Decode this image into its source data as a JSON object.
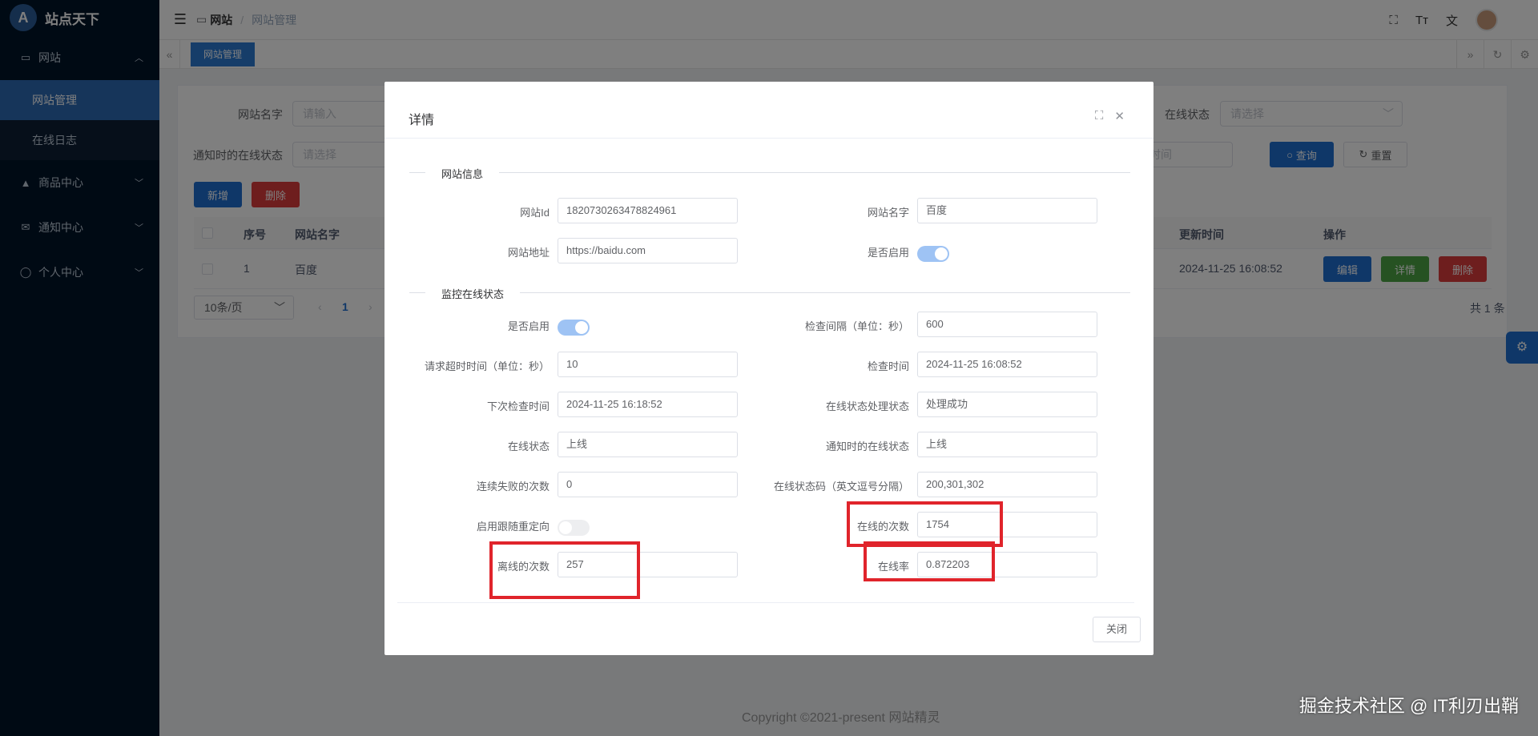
{
  "app": {
    "title": "站点天下",
    "logo_glyph": "A"
  },
  "sidebar": {
    "items": [
      {
        "label": "网站",
        "icon": "monitor-icon",
        "glyph": "▭",
        "expanded": true
      },
      {
        "label": "商品中心",
        "icon": "bag-icon",
        "glyph": "▲"
      },
      {
        "label": "通知中心",
        "icon": "mail-icon",
        "glyph": "✉"
      },
      {
        "label": "个人中心",
        "icon": "user-icon",
        "glyph": "◯"
      }
    ],
    "subitems": [
      {
        "label": "网站管理",
        "active": true
      },
      {
        "label": "在线日志"
      }
    ]
  },
  "header": {
    "breadcrumb": [
      "网站",
      "网站管理"
    ],
    "icons": [
      "fullscreen-icon",
      "font-size-icon",
      "translate-icon",
      "avatar"
    ]
  },
  "tags": {
    "active": "网站管理"
  },
  "filters": {
    "site_name_label": "网站名字",
    "site_name_placeholder": "请输入",
    "online_status_label": "在线状态",
    "online_status_placeholder": "请选择",
    "notify_status_label": "通知时的在线状态",
    "notify_status_placeholder": "请选择",
    "time_placeholder": "时间",
    "search_btn": "查询",
    "reset_btn": "重置"
  },
  "toolbar": {
    "add_btn": "新增",
    "delete_btn": "删除"
  },
  "table": {
    "headers": {
      "index": "序号",
      "name": "网站名字",
      "updated": "更新时间",
      "actions": "操作"
    },
    "rows": [
      {
        "index": "1",
        "name": "百度",
        "updated": "2024-11-25 16:08:52"
      }
    ],
    "row_actions": {
      "edit": "编辑",
      "detail": "详情",
      "delete": "删除"
    }
  },
  "pagination": {
    "page_size": "10条/页",
    "current": "1",
    "total": "共 1 条"
  },
  "footer": {
    "copyright": "Copyright ©2021-present 网站精灵"
  },
  "watermark": "掘金技术社区 @ IT利刃出鞘",
  "modal": {
    "title": "详情",
    "section1": "网站信息",
    "section2": "监控在线状态",
    "close_btn": "关闭",
    "fields": {
      "site_id_label": "网站Id",
      "site_id": "1820730263478824961",
      "site_name_label": "网站名字",
      "site_name": "百度",
      "site_url_label": "网站地址",
      "site_url": "https://baidu.com",
      "enabled_label": "是否启用",
      "enabled": true,
      "monitor_enabled_label": "是否启用",
      "monitor_enabled": true,
      "interval_label": "检查间隔（单位：秒）",
      "interval": "600",
      "timeout_label": "请求超时时间（单位：秒）",
      "timeout": "10",
      "check_time_label": "检查时间",
      "check_time": "2024-11-25 16:08:52",
      "next_check_label": "下次检查时间",
      "next_check": "2024-11-25 16:18:52",
      "process_status_label": "在线状态处理状态",
      "process_status": "处理成功",
      "online_status_label": "在线状态",
      "online_status": "上线",
      "notify_status_label": "通知时的在线状态",
      "notify_status": "上线",
      "fail_count_label": "连续失败的次数",
      "fail_count": "0",
      "status_codes_label": "在线状态码（英文逗号分隔）",
      "status_codes": "200,301,302",
      "follow_redirect_label": "启用跟随重定向",
      "follow_redirect": false,
      "online_count_label": "在线的次数",
      "online_count": "1754",
      "offline_count_label": "离线的次数",
      "offline_count": "257",
      "online_rate_label": "在线率",
      "online_rate": "0.872203"
    }
  },
  "colors": {
    "primary": "#1f6fd0",
    "danger": "#dc3d3d",
    "success": "#4ca545",
    "sidebar": "#001529",
    "highlight": "#e0242b"
  }
}
